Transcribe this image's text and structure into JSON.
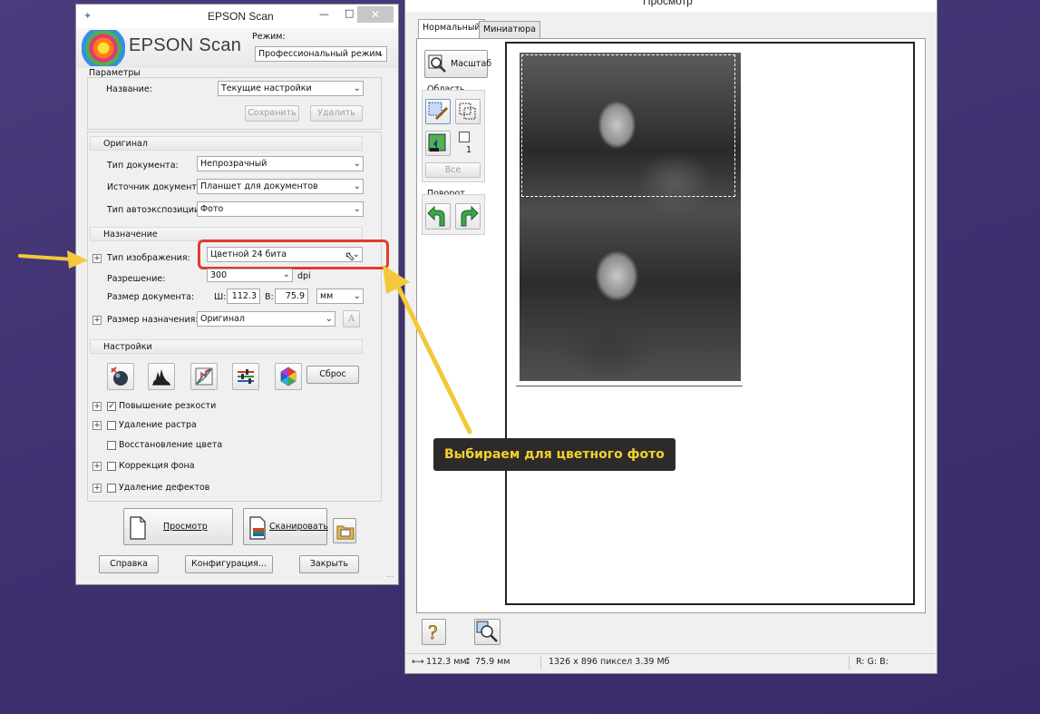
{
  "desktop_text": "",
  "epson": {
    "title": "EPSON Scan",
    "logo_text": "EPSON Scan",
    "mode_label": "Режим:",
    "mode_value": "Профессиональный режим",
    "params": {
      "header": "Параметры",
      "name_label": "Название:",
      "name_value": "Текущие настройки",
      "save_label": "Сохранить",
      "delete_label": "Удалить"
    },
    "original": {
      "header": "Оригинал",
      "doc_type_label": "Тип документа:",
      "doc_type_value": "Непрозрачный",
      "source_label": "Источник документа:",
      "source_value": "Планшет для документов",
      "autoexp_label": "Тип автоэкспозиции:",
      "autoexp_value": "Фото"
    },
    "destination": {
      "header": "Назначение",
      "image_type_label": "Тип изображения:",
      "image_type_value": "Цветной 24 бита",
      "resolution_label": "Разрешение:",
      "resolution_value": "300",
      "resolution_unit": "dpi",
      "docsize_label": "Размер документа:",
      "width_label": "Ш:",
      "width_value": "112.3",
      "height_label": "В:",
      "height_value": "75.9",
      "unit_value": "мм",
      "target_size_label": "Размер назначения:",
      "target_size_value": "Оригинал",
      "font_glyph": "A"
    },
    "settings": {
      "header": "Настройки",
      "reset_label": "Сброс",
      "options": [
        {
          "label": "Повышение резкости",
          "checked": true,
          "expandable": true
        },
        {
          "label": "Удаление растра",
          "checked": false,
          "expandable": true
        },
        {
          "label": "Восстановление цвета",
          "checked": false,
          "expandable": false
        },
        {
          "label": "Коррекция фона",
          "checked": false,
          "expandable": true
        },
        {
          "label": "Удаление дефектов",
          "checked": false,
          "expandable": true
        }
      ]
    },
    "buttons": {
      "preview": "Просмотр",
      "scan": "Сканировать",
      "help": "Справка",
      "config": "Конфигурация...",
      "close": "Закрыть"
    }
  },
  "preview": {
    "title": "Просмотр",
    "tabs": [
      "Нормальный",
      "Миниатюра"
    ],
    "zoom_label": "Масштаб",
    "area_label": "Область",
    "area_count": "1",
    "all_label": "Все",
    "rotate_label": "Поворот",
    "status": {
      "width": "112.3 мм",
      "height": "75.9 мм",
      "pixels": "1326 x 896 пиксел 3.39 Мб",
      "rgb": "R: G: B:"
    }
  },
  "annotation": {
    "tooltip": "Выбираем для цветного фото",
    "accent_color": "#f3c83a",
    "highlight_color": "#e23a2f"
  }
}
